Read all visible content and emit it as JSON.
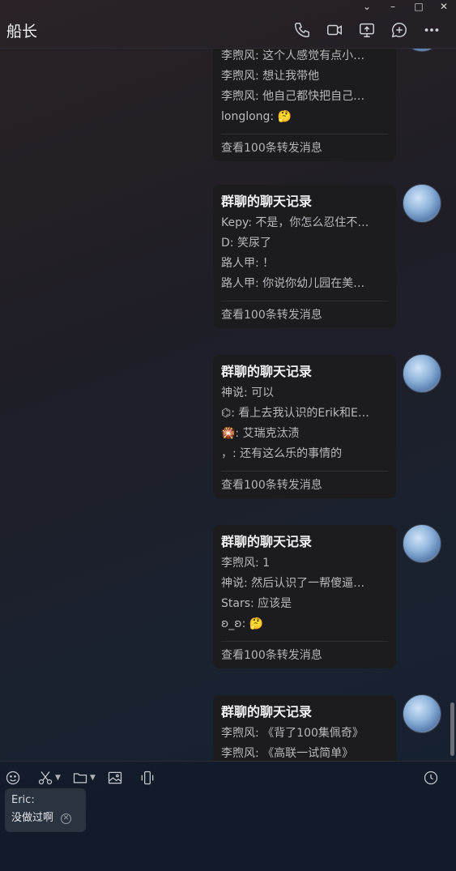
{
  "window": {
    "title": "船长",
    "controls": {
      "dropdown": "⌄",
      "minimize": "–",
      "maximize": "□",
      "close": "✕"
    }
  },
  "header_icons": [
    "phone-icon",
    "video-call-icon",
    "screen-share-icon",
    "add-chat-icon",
    "more-icon"
  ],
  "messages": [
    {
      "title": "",
      "lines": [
        "李煦风: 这个人感觉有点小…",
        "李煦风: 想让我带他",
        "李煦风: 他自己都快把自己…",
        "longlong: 🤔"
      ],
      "footer": "查看100条转发消息"
    },
    {
      "title": "群聊的聊天记录",
      "lines": [
        "Kepy: 不是，你怎么忍住不…",
        "D: 笑尿了",
        "路人甲: ！",
        "路人甲: 你说你幼儿园在美…"
      ],
      "footer": "查看100条转发消息"
    },
    {
      "title": "群聊的聊天记录",
      "lines": [
        "神说: 可以",
        "⌬: 看上去我认识的Erik和E…",
        "🎇: 艾瑞克汰渍",
        "，: 还有这么乐的事情的"
      ],
      "footer": "查看100条转发消息"
    },
    {
      "title": "群聊的聊天记录",
      "lines": [
        "李煦风: 1",
        "神说: 然后认识了一帮傻逼…",
        "Stars: 应该是",
        "ʚ_ʚ: 🤔"
      ],
      "footer": "查看100条转发消息"
    },
    {
      "title": "群聊的聊天记录",
      "lines": [
        "李煦风: 《背了100集佩奇》",
        "李煦风: 《高联一试简单》"
      ],
      "footer": ""
    }
  ],
  "toolbar_icons": [
    "emoji-icon",
    "scissors-icon",
    "folder-icon",
    "image-icon",
    "shake-icon",
    "history-icon"
  ],
  "quote": {
    "name": "Eric:",
    "text": "没做过啊",
    "close": "✕"
  }
}
